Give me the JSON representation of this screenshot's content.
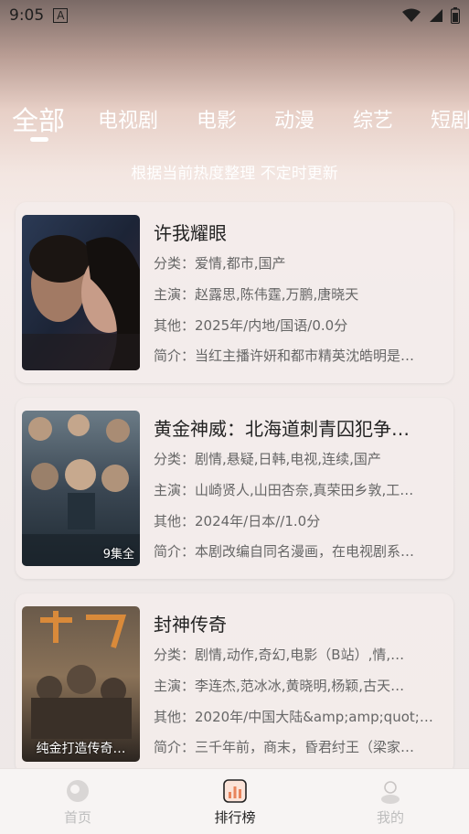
{
  "status": {
    "time": "9:05",
    "notification_letter": "A"
  },
  "tabs": [
    {
      "label": "全部",
      "active": true
    },
    {
      "label": "电视剧",
      "active": false
    },
    {
      "label": "电影",
      "active": false
    },
    {
      "label": "动漫",
      "active": false
    },
    {
      "label": "综艺",
      "active": false
    },
    {
      "label": "短剧",
      "active": false
    }
  ],
  "subtitle": "根据当前热度整理 不定时更新",
  "items": [
    {
      "title": "许我耀眼",
      "category": "分类：爱情,都市,国产",
      "cast": "主演：赵露思,陈伟霆,万鹏,唐晓天",
      "other": "其他：2025年/内地/国语/0.0分",
      "intro": "简介：当红主播许妍和都市精英沈皓明是…",
      "badge": "",
      "caption": ""
    },
    {
      "title": "黄金神威：北海道刺青囚犯争…",
      "category": "分类：剧情,悬疑,日韩,电视,连续,国产",
      "cast": "主演：山崎贤人,山田杏奈,真荣田乡敦,工…",
      "other": "其他：2024年/日本//1.0分",
      "intro": "简介：本剧改编自同名漫画，在电视剧系…",
      "badge": "9集全",
      "caption": ""
    },
    {
      "title": "封神传奇",
      "category": "分类：剧情,动作,奇幻,电影（B站）,情,…",
      "cast": "主演：李连杰,范冰冰,黄晓明,杨颖,古天…",
      "other": "其他：2020年/中国大陆&amp;amp;quot;…",
      "intro": "简介：三千年前，商末，昏君纣王（梁家…",
      "badge": "",
      "caption": "纯金打造传奇…"
    }
  ],
  "nav": [
    {
      "label": "首页",
      "icon": "home-icon",
      "active": false
    },
    {
      "label": "排行榜",
      "icon": "ranking-icon",
      "active": true
    },
    {
      "label": "我的",
      "icon": "profile-icon",
      "active": false
    }
  ],
  "colors": {
    "accent": "#e8845c",
    "active_text": "#222222",
    "inactive_text": "#bdbdbd"
  }
}
